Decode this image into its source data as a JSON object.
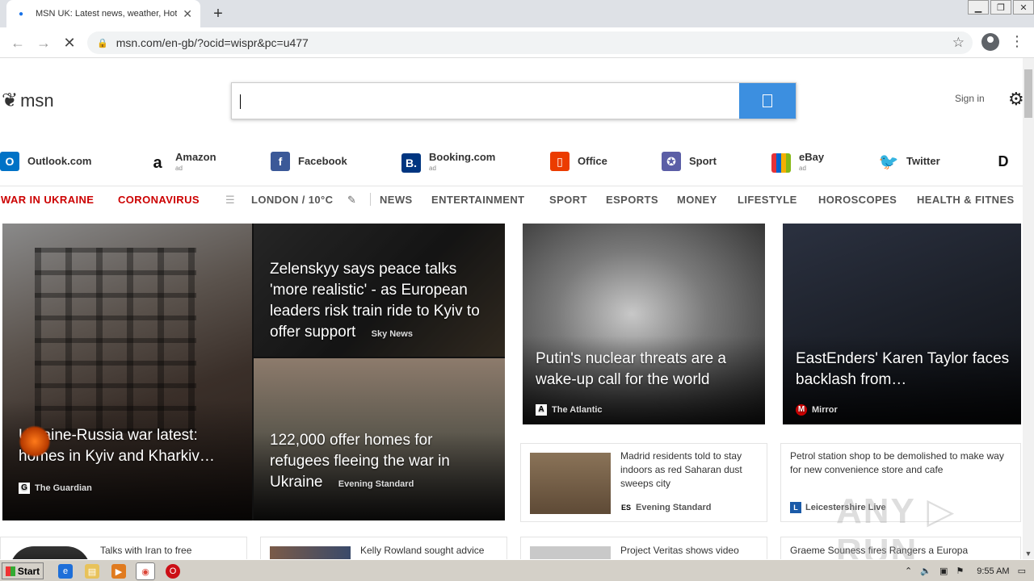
{
  "browser": {
    "tab_title": "MSN UK: Latest news, weather, Hot",
    "tab_close": "✕",
    "new_tab": "+",
    "url": "msn.com/en-gb/?ocid=wispr&pc=u477"
  },
  "header": {
    "logo_text": "msn",
    "sign_in": "Sign in"
  },
  "quicklinks": [
    {
      "label": "Outlook.com",
      "ad": "",
      "icon": "outlook-icon",
      "color": "#0072c6"
    },
    {
      "label": "Amazon",
      "ad": "ad",
      "icon": "amazon-icon",
      "color": "#ffffff"
    },
    {
      "label": "Facebook",
      "ad": "",
      "icon": "facebook-icon",
      "color": "#3b5998"
    },
    {
      "label": "Booking.com",
      "ad": "ad",
      "icon": "booking-icon",
      "color": "#003580"
    },
    {
      "label": "Office",
      "ad": "",
      "icon": "office-icon",
      "color": "#eb3c00"
    },
    {
      "label": "Sport",
      "ad": "",
      "icon": "sport-icon",
      "color": "#5b5ea6"
    },
    {
      "label": "eBay",
      "ad": "ad",
      "icon": "ebay-icon",
      "color": "#86b817"
    },
    {
      "label": "Twitter",
      "ad": "",
      "icon": "twitter-icon",
      "color": "#1da1f2"
    }
  ],
  "nav": {
    "war": "WAR IN UKRAINE",
    "corona": "CORONAVIRUS",
    "weather": "LONDON / 10°C",
    "items": [
      "NEWS",
      "ENTERTAINMENT",
      "SPORT",
      "ESPORTS",
      "MONEY",
      "LIFESTYLE",
      "HOROSCOPES",
      "HEALTH & FITNES"
    ]
  },
  "hero": {
    "main": {
      "title": "Ukraine-Russia war latest: homes in Kyiv and Kharkiv…",
      "source": "The Guardian",
      "logo": "G"
    },
    "top_right": {
      "title": "Zelenskyy says peace talks 'more realistic' - as European leaders risk train ride to Kyiv to offer support",
      "source": "Sky News"
    },
    "bottom_right": {
      "title": "122,000 offer homes for refugees fleeing the war in Ukraine",
      "source": "Evening Standard"
    }
  },
  "cards": {
    "putin": {
      "title": "Putin's nuclear threats are a wake-up call for the world",
      "source": "The Atlantic",
      "logo": "A"
    },
    "eastenders": {
      "title": "EastEnders' Karen Taylor faces backlash from…",
      "source": "Mirror",
      "logo": "M"
    },
    "madrid": {
      "title": "Madrid residents told to stay indoors as red Saharan dust sweeps city",
      "source": "Evening Standard",
      "logo": "ES"
    },
    "petrol": {
      "title": "Petrol station shop to be demolished to make way for new convenience store and cafe",
      "source": "Leicestershire Live",
      "logo": "L"
    }
  },
  "row3": {
    "iran": "Talks with Iran to free",
    "kelly": "Kelly Rowland sought advice",
    "veritas": "Project Veritas shows video",
    "souness": "Graeme Souness fires Rangers a Europa"
  },
  "taskbar": {
    "start": "Start",
    "time": "9:55 AM"
  }
}
